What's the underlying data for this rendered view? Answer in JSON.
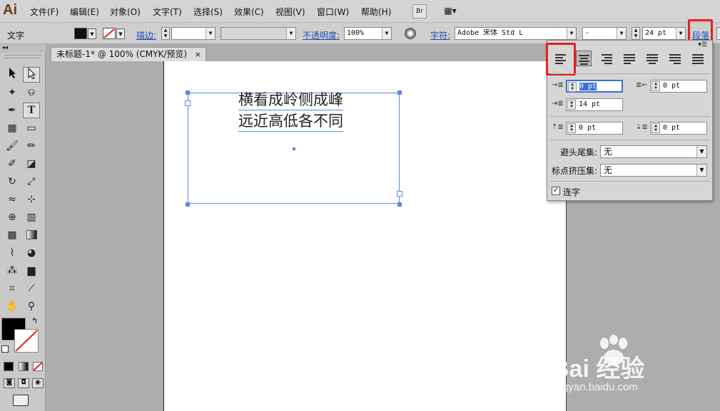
{
  "app": {
    "logo": "Ai"
  },
  "menu": [
    "文件(F)",
    "编辑(E)",
    "对象(O)",
    "文字(T)",
    "选择(S)",
    "效果(C)",
    "视图(V)",
    "窗口(W)",
    "帮助(H)"
  ],
  "menubar_buttons": {
    "bridge": "Br",
    "workspace": "▦▾"
  },
  "control": {
    "tool_label": "文字",
    "stroke_label": "描边:",
    "opacity_label": "不透明度:",
    "opacity_value": "100%",
    "char_label": "字符:",
    "font_family": "Adobe 宋体 Std L",
    "font_style": "-",
    "font_size": "24 pt",
    "para_label": "段落"
  },
  "document": {
    "tab_title": "未标题-1* @ 100% (CMYK/预览)",
    "close": "×"
  },
  "canvas": {
    "lines": [
      "横看成岭侧成峰",
      "远近高低各不同"
    ]
  },
  "paragraph_panel": {
    "left_indent": "0 pt",
    "right_indent": "0 pt",
    "first_line_indent": "14 pt",
    "space_before": "0 pt",
    "space_after": "0 pt",
    "kinsoku_label": "避头尾集:",
    "kinsoku_value": "无",
    "mojikumi_label": "标点挤压集:",
    "mojikumi_value": "无",
    "hyphenate_label": "连字",
    "hyphenate_checked": true,
    "active_alignment": "align-left"
  },
  "watermark": {
    "brand": "Bai  经验",
    "url": "jingyan.baidu.com"
  },
  "colors": {
    "highlight_box": "#e52020",
    "selection": "#5b86e5",
    "link": "#1d4fb3"
  }
}
